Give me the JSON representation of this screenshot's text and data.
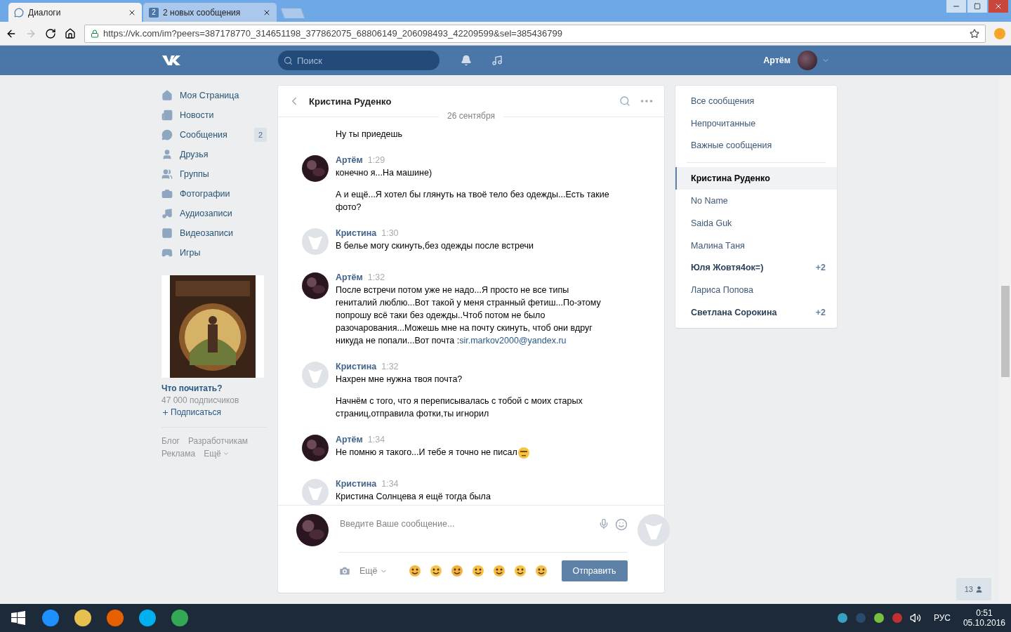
{
  "browser": {
    "tabs": [
      {
        "title": "Диалоги",
        "selected": true
      },
      {
        "title": "2 новых сообщения",
        "badge": "2",
        "selected": false
      }
    ],
    "url": "https://vk.com/im?peers=387178770_314651198_377862075_68806149_206098493_42209599&sel=385436799"
  },
  "header": {
    "search_placeholder": "Поиск",
    "user_name": "Артём"
  },
  "nav": {
    "items": [
      {
        "label": "Моя Страница"
      },
      {
        "label": "Новости"
      },
      {
        "label": "Сообщения",
        "count": "2"
      },
      {
        "label": "Друзья"
      },
      {
        "label": "Группы"
      },
      {
        "label": "Фотографии"
      },
      {
        "label": "Аудиозаписи"
      },
      {
        "label": "Видеозаписи"
      },
      {
        "label": "Игры"
      }
    ],
    "ad": {
      "title": "Что почитать?",
      "subscribers": "47 000 подписчиков",
      "subscribe": "Подписаться"
    },
    "footer": [
      "Блог",
      "Разработчикам",
      "Реклама",
      "Ещё"
    ]
  },
  "chat": {
    "title": "Кристина Руденко",
    "date": "26 сентября",
    "messages": [
      {
        "paragraphs": [
          "Ну ты приедешь"
        ]
      },
      {
        "kind": "own",
        "author": "Артём",
        "time": "1:29",
        "paragraphs": [
          "конечно я...На машине)",
          "А и ещё...Я хотел бы глянуть на твоё тело без одежды...Есть такие фото?"
        ]
      },
      {
        "kind": "other",
        "author": "Кристина",
        "time": "1:30",
        "paragraphs": [
          "В белье могу скинуть,без одежды после встречи"
        ]
      },
      {
        "kind": "own",
        "author": "Артём",
        "time": "1:32",
        "paragraphs": [
          "После встречи потом уже не надо...Я просто не все типы гениталий люблю...Вот такой у меня странный фетиш...По-этому попрошу всё таки без одежды..Чтоб потом не было разочарования...Можешь мне на почту скинуть, чтоб они вдруг никуда не попали...Вот почта :"
        ],
        "link": "sir.markov2000@yandex.ru"
      },
      {
        "kind": "other",
        "author": "Кристина",
        "time": "1:32",
        "paragraphs": [
          "Нахрен мне нужна твоя почта?",
          "Начнём с того, что я переписывалась с тобой с моих старых страниц,отправила фотки,ты игнорил"
        ]
      },
      {
        "kind": "own",
        "author": "Артём",
        "time": "1:34",
        "paragraphs": [
          "Не помню я такого...И тебе я точно не писал"
        ],
        "emoji": true
      },
      {
        "kind": "other",
        "author": "Кристина",
        "time": "1:34",
        "paragraphs": [
          "Кристина Солнцева я ещё тогда была"
        ]
      }
    ],
    "composer": {
      "placeholder": "Введите Ваше сообщение...",
      "more": "Ещё",
      "send": "Отправить"
    }
  },
  "filters": [
    {
      "label": "Все сообщения",
      "selected": false
    },
    {
      "label": "Непрочитанные",
      "selected": false
    },
    {
      "label": "Важные сообщения",
      "selected": false
    }
  ],
  "conversations": [
    {
      "name": "Кристина Руденко",
      "selected": true,
      "unread": false
    },
    {
      "name": "No Name",
      "selected": false,
      "unread": false
    },
    {
      "name": "Saida Guk",
      "selected": false,
      "unread": false
    },
    {
      "name": "Малина Таня",
      "selected": false,
      "unread": false
    },
    {
      "name": "Юля Жовтя4ок=)",
      "selected": false,
      "unread": true,
      "count": "+2"
    },
    {
      "name": "Лариса Попова",
      "selected": false,
      "unread": false
    },
    {
      "name": "Светлана Сорокина",
      "selected": false,
      "unread": true,
      "count": "+2"
    }
  ],
  "online_counter": "13",
  "taskbar": {
    "language": "РУС",
    "time": "0:51",
    "date": "05.10.2016"
  }
}
